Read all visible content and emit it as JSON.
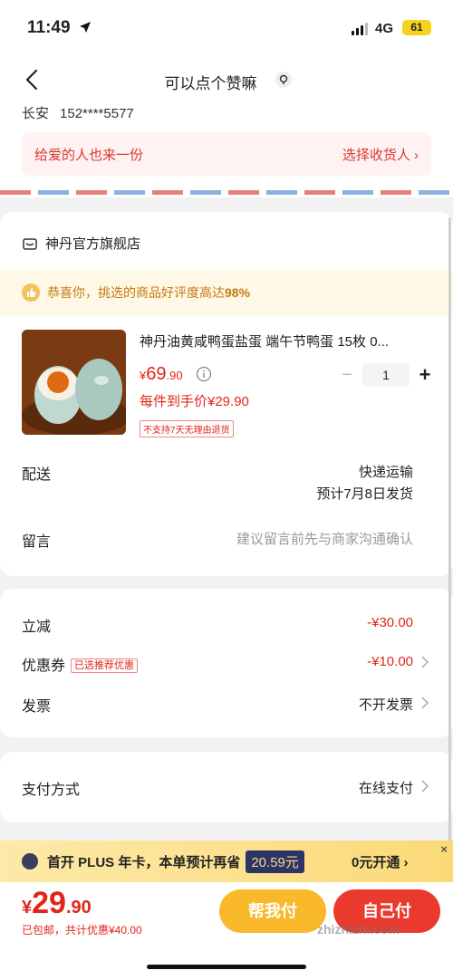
{
  "status": {
    "time": "11:49",
    "network": "4G",
    "battery": "61"
  },
  "nav": {
    "title": "可以点个赞嘛"
  },
  "address": {
    "name": "长安",
    "phone": "152****5577"
  },
  "gift": {
    "text": "给爱的人也来一份",
    "action": "选择收货人"
  },
  "shop": {
    "name": "神丹官方旗舰店",
    "praise_prefix": "恭喜你，挑选的商品好评度高达",
    "praise_value": "98%"
  },
  "product": {
    "title": "神丹油黄咸鸭蛋盐蛋 端午节鸭蛋 15枚 0...",
    "price_symbol": "¥",
    "price_int": "69",
    "price_dec": ".90",
    "quantity": "1",
    "unit_price": "每件到手价¥29.90",
    "return_policy": "不支持7天无理由退货"
  },
  "shipping": {
    "label": "配送",
    "method": "快递运输",
    "eta": "预计7月8日发货"
  },
  "note": {
    "label": "留言",
    "placeholder": "建议留言前先与商家沟通确认"
  },
  "discounts": {
    "instant_label": "立减",
    "instant_value": "-¥30.00",
    "coupon_label": "优惠券",
    "coupon_tag": "已选推荐优惠",
    "coupon_value": "-¥10.00",
    "invoice_label": "发票",
    "invoice_value": "不开发票"
  },
  "payment": {
    "label": "支付方式",
    "value": "在线支付"
  },
  "plus_promo": {
    "text": "首开 PLUS 年卡，本单预计再省",
    "save": "20.59元",
    "action": "0元开通 ›",
    "close": "×"
  },
  "checkout": {
    "total_symbol": "¥",
    "total_int": "29",
    "total_dec": ".90",
    "total_note": "已包邮，共计优惠¥40.00",
    "help_pay": "帮我付",
    "self_pay": "自己付",
    "watermark": "zhizhizhi.com"
  },
  "colors": {
    "accent": "#e1251b",
    "help": "#f9b92a",
    "promo": "#fbd978"
  }
}
